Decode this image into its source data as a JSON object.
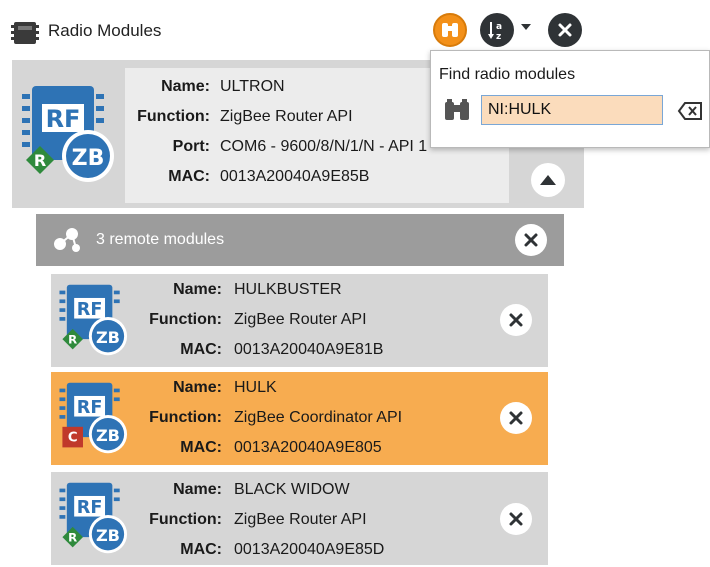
{
  "header": {
    "title": "Radio Modules",
    "icons": {
      "module": "radio-module-icon",
      "find": "binoculars-icon",
      "sort": "sort-az-icon",
      "dropdown": "chevron-down-icon",
      "close": "close-icon"
    }
  },
  "labels": {
    "name": "Name:",
    "function": "Function:",
    "port": "Port:",
    "mac": "MAC:"
  },
  "local_module": {
    "name": "ULTRON",
    "function": "ZigBee Router API",
    "port": "COM6 - 9600/8/N/1/N - API 1",
    "mac": "0013A20040A9E85B",
    "role_badge": "R",
    "icon_text": {
      "top": "RF",
      "bottom": "ZB"
    }
  },
  "remote": {
    "header_label": "3 remote modules",
    "modules": [
      {
        "name": "HULKBUSTER",
        "function": "ZigBee Router API",
        "mac": "0013A20040A9E81B",
        "role_badge": "R",
        "selected": false
      },
      {
        "name": "HULK",
        "function": "ZigBee Coordinator API",
        "mac": "0013A20040A9E805",
        "role_badge": "C",
        "selected": true
      },
      {
        "name": "BLACK WIDOW",
        "function": "ZigBee Router API",
        "mac": "0013A20040A9E85D",
        "role_badge": "R",
        "selected": false
      }
    ]
  },
  "find_popup": {
    "title": "Find radio modules",
    "value": "NI:HULK"
  },
  "colors": {
    "accent_orange": "#f39019",
    "selected_row": "#f7ac50",
    "card_gray": "#d6d6d6",
    "header_gray": "#9c9c9c",
    "icon_blue": "#2e73b5",
    "router_green": "#2f8a3c",
    "coordinator_red": "#c0392b"
  }
}
